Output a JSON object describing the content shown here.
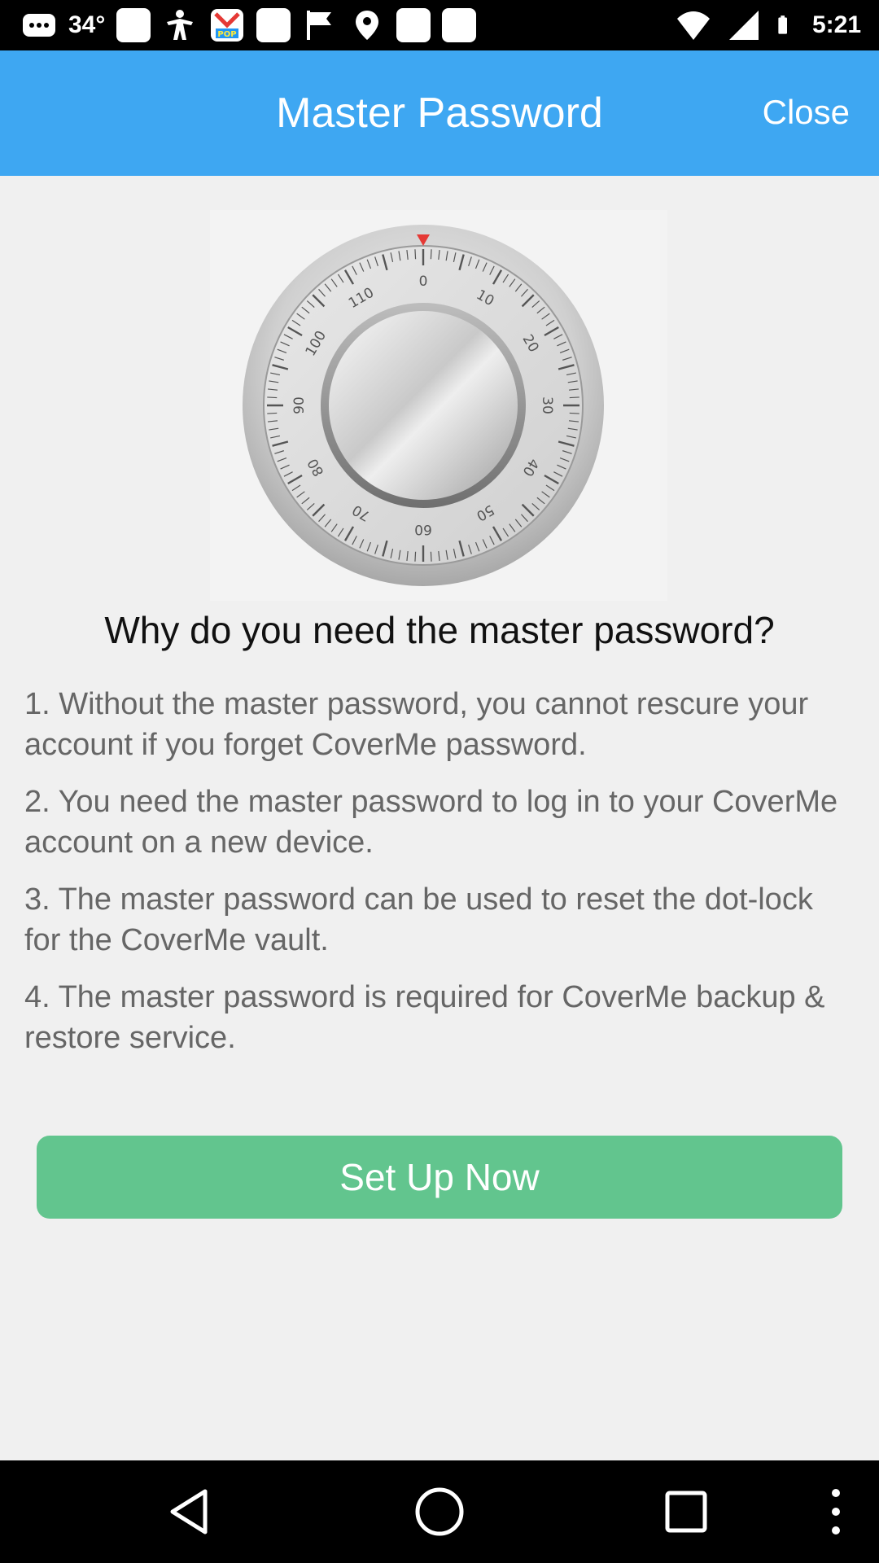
{
  "status_bar": {
    "signal_text": "34°",
    "time": "5:21",
    "icons": [
      "messages-icon",
      "notification-square-icon",
      "figure-icon",
      "pop-app-icon",
      "square-icon",
      "flag-icon",
      "location-pin-icon",
      "square-icon",
      "square-icon",
      "wifi-icon",
      "cellular-signal-icon",
      "battery-icon"
    ]
  },
  "app_bar": {
    "title": "Master Password",
    "close_label": "Close"
  },
  "dial": {
    "numbers": [
      "0",
      "10",
      "20",
      "30",
      "40",
      "50",
      "60",
      "70",
      "80",
      "90",
      "100",
      "110"
    ]
  },
  "content": {
    "question": "Why do you need the master password?",
    "reasons": [
      "1. Without the master password, you cannot rescure your account if you forget CoverMe password.",
      "2. You need the master password to log in to your CoverMe account on a new device.",
      "3. The master password can be used to reset the dot-lock for the CoverMe vault.",
      "4. The master password is required for CoverMe backup & restore service."
    ],
    "setup_label": "Set Up Now"
  },
  "colors": {
    "app_bar": "#3ea7f2",
    "button": "#62c58e",
    "background": "#f0f0f0"
  },
  "nav_bar": {
    "icons": [
      "back-icon",
      "home-icon",
      "recents-icon",
      "menu-icon"
    ]
  }
}
